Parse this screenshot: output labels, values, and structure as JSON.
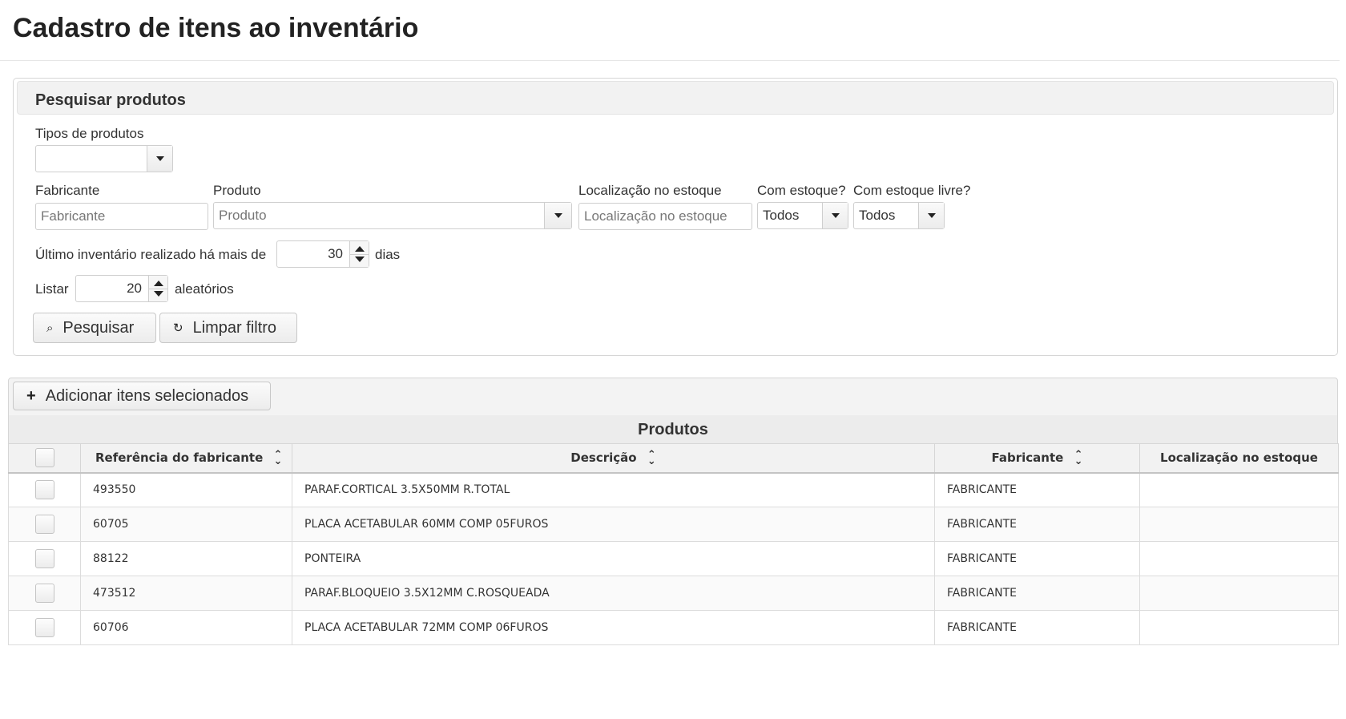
{
  "page": {
    "title": "Cadastro de itens ao inventário"
  },
  "search": {
    "header": "Pesquisar produtos",
    "tipos_label": "Tipos de produtos",
    "tipos_value": "",
    "fabricante_label": "Fabricante",
    "fabricante_placeholder": "Fabricante",
    "produto_label": "Produto",
    "produto_placeholder": "Produto",
    "localizacao_label": "Localização no estoque",
    "localizacao_placeholder": "Localização no estoque",
    "com_estoque_label": "Com estoque?",
    "com_estoque_value": "Todos",
    "com_estoque_livre_label": "Com estoque livre?",
    "com_estoque_livre_value": "Todos",
    "ultimo_inventario_prefix": "Último inventário realizado há mais de",
    "ultimo_inventario_value": "30",
    "ultimo_inventario_suffix": "dias",
    "listar_prefix": "Listar",
    "listar_value": "20",
    "listar_suffix": "aleatórios",
    "search_button": "Pesquisar",
    "clear_button": "Limpar filtro"
  },
  "toolbar": {
    "add_button": "Adicionar itens selecionados"
  },
  "table": {
    "caption": "Produtos",
    "columns": [
      "Referência do fabricante",
      "Descrição",
      "Fabricante",
      "Localização no estoque"
    ],
    "rows": [
      {
        "ref": "493550",
        "desc": "PARAF.CORTICAL 3.5X50MM R.TOTAL",
        "fab": "FABRICANTE",
        "loc": ""
      },
      {
        "ref": "60705",
        "desc": "PLACA ACETABULAR 60MM COMP 05FUROS",
        "fab": "FABRICANTE",
        "loc": ""
      },
      {
        "ref": "88122",
        "desc": "PONTEIRA",
        "fab": "FABRICANTE",
        "loc": ""
      },
      {
        "ref": "473512",
        "desc": "PARAF.BLOQUEIO 3.5X12MM C.ROSQUEADA",
        "fab": "FABRICANTE",
        "loc": ""
      },
      {
        "ref": "60706",
        "desc": "PLACA ACETABULAR 72MM COMP 06FUROS",
        "fab": "FABRICANTE",
        "loc": ""
      }
    ]
  },
  "icons": {
    "search": "magnifier-icon",
    "clear": "refresh-icon",
    "add": "plus-icon"
  }
}
